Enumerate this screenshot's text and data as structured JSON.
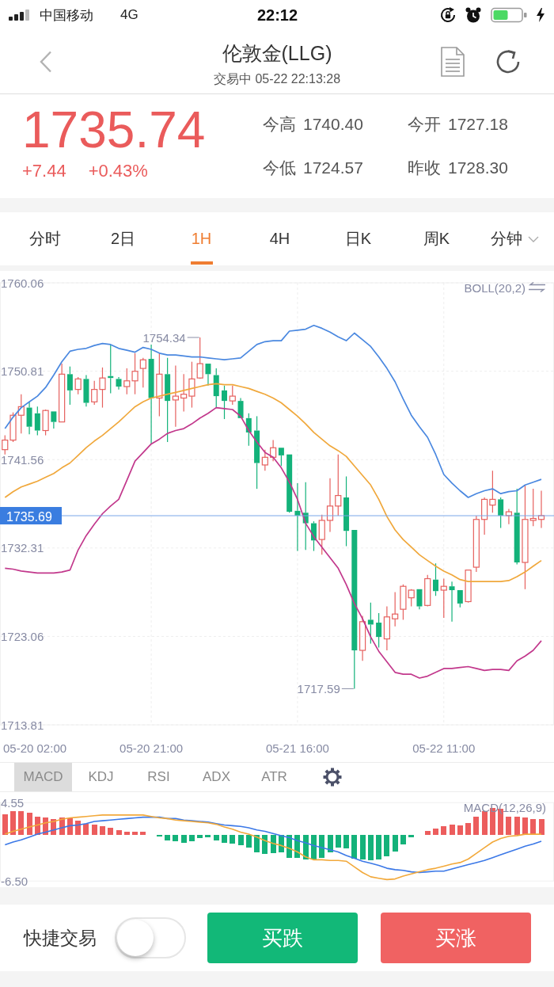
{
  "status_bar": {
    "carrier": "中国移动",
    "network": "4G",
    "time": "22:12"
  },
  "nav": {
    "title": "伦敦金(LLG)",
    "subtitle": "交易中 05-22 22:13:28"
  },
  "quote": {
    "price": "1735.74",
    "change": "+7.44",
    "change_percent": "+0.43%",
    "stats": [
      {
        "label": "今高",
        "value": "1740.40"
      },
      {
        "label": "今开",
        "value": "1727.18"
      },
      {
        "label": "今低",
        "value": "1724.57"
      },
      {
        "label": "昨收",
        "value": "1728.30"
      }
    ]
  },
  "period_tabs": [
    {
      "label": "分时",
      "selected": false,
      "dropdown": false
    },
    {
      "label": "2日",
      "selected": false,
      "dropdown": false
    },
    {
      "label": "1H",
      "selected": true,
      "dropdown": false
    },
    {
      "label": "4H",
      "selected": false,
      "dropdown": false
    },
    {
      "label": "日K",
      "selected": false,
      "dropdown": false
    },
    {
      "label": "周K",
      "selected": false,
      "dropdown": false
    },
    {
      "label": "分钟",
      "selected": false,
      "dropdown": true
    }
  ],
  "main_chart": {
    "chart_data": {
      "type": "candlestick",
      "title": "BOLL(20,2)",
      "grid": true,
      "categories": [
        null,
        null,
        null,
        null,
        null,
        null,
        null,
        null,
        null,
        null,
        null,
        null,
        null,
        null,
        null,
        null,
        null,
        null,
        "05-20 21:00",
        null,
        null,
        null,
        null,
        null,
        null,
        null,
        null,
        null,
        null,
        null,
        null,
        null,
        null,
        null,
        null,
        null,
        "05-21 16:00",
        null,
        null,
        null,
        null,
        null,
        null,
        null,
        null,
        null,
        null,
        null,
        null,
        null,
        null,
        null,
        null,
        null,
        "05-22 11:00",
        null,
        null,
        null,
        null,
        null,
        null,
        null,
        null,
        null,
        null,
        null,
        null
      ],
      "ylim": [
        1713.81,
        1760.06
      ],
      "yticks": [
        1760.06,
        1750.81,
        1741.56,
        1732.31,
        1723.06,
        1713.81
      ],
      "ohlc": [
        [
          1742.6,
          1744.1,
          1742.1,
          1743.6
        ],
        [
          1743.6,
          1746.5,
          1743.4,
          1746.2
        ],
        [
          1746.2,
          1748.4,
          1744.3,
          1747.1
        ],
        [
          1747.0,
          1747.6,
          1744.2,
          1745.0
        ],
        [
          1746.4,
          1747.1,
          1744.1,
          1744.6
        ],
        [
          1744.6,
          1746.8,
          1744.1,
          1746.7
        ],
        [
          1746.6,
          1746.6,
          1744.8,
          1745.5
        ],
        [
          1745.5,
          1751.6,
          1745.5,
          1750.5
        ],
        [
          1750.5,
          1751.3,
          1747.3,
          1748.8
        ],
        [
          1748.9,
          1750.2,
          1748.4,
          1750.0
        ],
        [
          1750.0,
          1750.4,
          1747.1,
          1747.5
        ],
        [
          1747.6,
          1749.8,
          1747.3,
          1748.9
        ],
        [
          1748.9,
          1751.2,
          1747.0,
          1750.1
        ],
        [
          1750.3,
          1753.6,
          1748.5,
          1750.1
        ],
        [
          1750.0,
          1750.2,
          1748.9,
          1749.2
        ],
        [
          1749.2,
          1751.1,
          1748.4,
          1749.8
        ],
        [
          1749.8,
          1752.7,
          1748.4,
          1750.8
        ],
        [
          1751.1,
          1752.2,
          1749.1,
          1752.0
        ],
        [
          1752.1,
          1753.6,
          1743.2,
          1748.0
        ],
        [
          1748.0,
          1752.7,
          1746.1,
          1750.5
        ],
        [
          1750.5,
          1752.2,
          1743.4,
          1747.7
        ],
        [
          1747.8,
          1751.4,
          1745.0,
          1748.2
        ],
        [
          1748.0,
          1750.5,
          1746.6,
          1748.4
        ],
        [
          1748.2,
          1751.8,
          1747.0,
          1750.0
        ],
        [
          1750.1,
          1754.34,
          1750.0,
          1751.6
        ],
        [
          1751.6,
          1751.6,
          1749.3,
          1750.5
        ],
        [
          1750.4,
          1751.1,
          1747.0,
          1748.2
        ],
        [
          1748.8,
          1749.3,
          1745.8,
          1747.7
        ],
        [
          1747.7,
          1749.3,
          1747.3,
          1748.2
        ],
        [
          1747.7,
          1748.0,
          1745.9,
          1745.9
        ],
        [
          1745.9,
          1746.4,
          1743.0,
          1744.4
        ],
        [
          1744.6,
          1746.1,
          1738.5,
          1741.2
        ],
        [
          1741.0,
          1742.6,
          1740.4,
          1741.8
        ],
        [
          1741.8,
          1743.6,
          1741.4,
          1742.8
        ],
        [
          1742.8,
          1742.8,
          1740.9,
          1742.0
        ],
        [
          1742.1,
          1742.1,
          1736.0,
          1736.1
        ],
        [
          1736.2,
          1739.1,
          1732.0,
          1735.7
        ],
        [
          1736.0,
          1739.2,
          1732.1,
          1734.9
        ],
        [
          1734.9,
          1735.1,
          1732.0,
          1733.1
        ],
        [
          1733.2,
          1735.8,
          1731.6,
          1735.2
        ],
        [
          1735.2,
          1739.6,
          1734.0,
          1736.7
        ],
        [
          1736.7,
          1742.1,
          1735.7,
          1737.8
        ],
        [
          1737.6,
          1739.8,
          1732.5,
          1734.1
        ],
        [
          1734.2,
          1734.2,
          1717.59,
          1721.6
        ],
        [
          1721.6,
          1725.2,
          1720.5,
          1724.6
        ],
        [
          1724.8,
          1726.6,
          1722.3,
          1724.3
        ],
        [
          1724.5,
          1725.5,
          1721.9,
          1723.0
        ],
        [
          1722.8,
          1726.2,
          1721.6,
          1725.1
        ],
        [
          1724.9,
          1727.7,
          1724.1,
          1725.4
        ],
        [
          1725.9,
          1728.5,
          1724.8,
          1728.3
        ],
        [
          1727.1,
          1728.0,
          1726.2,
          1727.9
        ],
        [
          1728.0,
          1728.0,
          1725.9,
          1726.2
        ],
        [
          1726.3,
          1729.5,
          1726.2,
          1729.1
        ],
        [
          1729.0,
          1730.7,
          1727.3,
          1727.8
        ],
        [
          1727.9,
          1729.1,
          1725.0,
          1728.3
        ],
        [
          1728.3,
          1728.8,
          1724.6,
          1727.9
        ],
        [
          1727.9,
          1727.9,
          1726.1,
          1726.5
        ],
        [
          1726.7,
          1730.0,
          1726.6,
          1730.0
        ],
        [
          1730.3,
          1735.7,
          1729.8,
          1735.3
        ],
        [
          1735.3,
          1737.6,
          1733.7,
          1737.4
        ],
        [
          1736.8,
          1740.4,
          1736.0,
          1737.4
        ],
        [
          1737.4,
          1737.6,
          1734.4,
          1735.7
        ],
        [
          1735.7,
          1736.4,
          1734.8,
          1736.1
        ],
        [
          1736.0,
          1738.5,
          1730.6,
          1730.8
        ],
        [
          1730.8,
          1738.9,
          1728.0,
          1735.3
        ],
        [
          1735.2,
          1738.5,
          1734.6,
          1735.4
        ],
        [
          1735.3,
          1738.3,
          1734.4,
          1735.7
        ]
      ],
      "series": [
        {
          "type": "line",
          "color": "#4a88e0",
          "values": [
            1744.8,
            1746.0,
            1747.0,
            1747.6,
            1748.2,
            1749.1,
            1750.4,
            1751.8,
            1752.9,
            1753.1,
            1753.2,
            1753.5,
            1753.7,
            1753.6,
            1753.2,
            1753.0,
            1752.8,
            1753.3,
            1753.1,
            1752.7,
            1752.5,
            1752.5,
            1752.4,
            1752.3,
            1752.3,
            1752.2,
            1752.1,
            1752.0,
            1752.1,
            1752.2,
            1752.9,
            1753.6,
            1753.9,
            1754.0,
            1754.0,
            1755.0,
            1755.1,
            1755.2,
            1755.6,
            1755.3,
            1754.9,
            1754.4,
            1754.0,
            1754.8,
            1754.1,
            1753.4,
            1752.3,
            1751.1,
            1749.7,
            1747.9,
            1746.2,
            1745.0,
            1743.9,
            1742.1,
            1740.0,
            1739.1,
            1738.3,
            1737.6,
            1738.0,
            1738.3,
            1738.5,
            1738.0,
            1738.2,
            1738.3,
            1738.9,
            1739.2,
            1739.5
          ]
        },
        {
          "type": "line",
          "color": "#f0a83c",
          "values": [
            1737.6,
            1738.2,
            1738.7,
            1739.0,
            1739.3,
            1739.7,
            1740.1,
            1740.7,
            1741.2,
            1742.0,
            1742.8,
            1743.5,
            1744.1,
            1744.8,
            1745.5,
            1746.3,
            1747.1,
            1747.6,
            1748.0,
            1748.2,
            1748.4,
            1748.6,
            1748.8,
            1749.0,
            1749.2,
            1749.4,
            1749.5,
            1749.4,
            1749.4,
            1749.2,
            1749.0,
            1748.7,
            1748.4,
            1748.0,
            1747.5,
            1746.8,
            1746.1,
            1745.3,
            1744.4,
            1743.7,
            1743.0,
            1742.5,
            1741.9,
            1740.9,
            1739.9,
            1738.9,
            1737.4,
            1735.6,
            1734.2,
            1733.2,
            1732.4,
            1731.6,
            1731.0,
            1730.4,
            1729.9,
            1729.5,
            1729.0,
            1728.8,
            1728.8,
            1728.8,
            1728.8,
            1728.8,
            1728.9,
            1729.3,
            1729.8,
            1730.4,
            1731.0
          ]
        },
        {
          "type": "line",
          "color": "#c2388c",
          "values": [
            1730.2,
            1730.1,
            1729.9,
            1729.8,
            1729.7,
            1729.7,
            1729.7,
            1729.8,
            1730.0,
            1732.1,
            1733.6,
            1734.8,
            1735.9,
            1736.7,
            1737.4,
            1739.4,
            1741.4,
            1742.3,
            1743.2,
            1743.7,
            1744.3,
            1744.6,
            1744.8,
            1745.3,
            1745.9,
            1746.4,
            1747.0,
            1746.9,
            1746.8,
            1746.1,
            1744.6,
            1743.4,
            1742.3,
            1741.8,
            1740.7,
            1739.2,
            1737.4,
            1734.9,
            1733.5,
            1732.4,
            1731.3,
            1730.2,
            1728.5,
            1726.5,
            1724.9,
            1723.0,
            1721.5,
            1720.4,
            1719.3,
            1719.1,
            1719.1,
            1718.7,
            1718.9,
            1719.3,
            1719.7,
            1719.7,
            1719.8,
            1719.9,
            1719.7,
            1719.5,
            1719.6,
            1719.6,
            1719.5,
            1720.5,
            1721.0,
            1721.6,
            1722.6
          ]
        }
      ],
      "ref_lines": [
        {
          "axis": "y",
          "value": 1735.69,
          "label": "1735.69",
          "color": "#7aa6e8"
        }
      ],
      "annotations": [
        "1754.34",
        "1717.59",
        "05-20 02:00"
      ]
    }
  },
  "indicator_tabs": [
    {
      "label": "MACD",
      "selected": true
    },
    {
      "label": "KDJ",
      "selected": false
    },
    {
      "label": "RSI",
      "selected": false
    },
    {
      "label": "ADX",
      "selected": false
    },
    {
      "label": "ATR",
      "selected": false
    }
  ],
  "macd_chart": {
    "chart_data": {
      "type": "bar",
      "title": "MACD(12,26,9)",
      "ylim": [
        -6.5,
        4.55
      ],
      "yticks": [
        4.55,
        {
          "value": -6.5,
          "label": "-6.50"
        }
      ],
      "series": [
        {
          "values": [
            2.9,
            3.3,
            3.4,
            3.1,
            2.6,
            2.5,
            2.2,
            2.5,
            2.3,
            2.0,
            1.6,
            1.4,
            1.2,
            1.0,
            0.7,
            0.5,
            0.5,
            0.5,
            null,
            -0.2,
            -0.8,
            -0.9,
            -1.1,
            -0.9,
            -0.4,
            -0.3,
            -0.8,
            -1.1,
            -1.2,
            -1.4,
            -1.8,
            -2.5,
            -2.7,
            -2.6,
            -2.5,
            -3.2,
            -3.2,
            -3.5,
            -3.5,
            -3.2,
            -2.5,
            -1.8,
            -1.9,
            -3.3,
            -3.5,
            -3.6,
            -3.5,
            -3.0,
            -2.3,
            -1.3,
            -0.3,
            null,
            0.6,
            0.9,
            1.2,
            1.4,
            1.3,
            1.7,
            2.6,
            3.3,
            3.8,
            3.7,
            2.6,
            2.6,
            2.4,
            2.2,
            2.2
          ],
          "colors": [
            "#ec5d5d",
            "#ec5d5d",
            "#ec5d5d",
            "#ec5d5d",
            "#ec5d5d",
            "#ec5d5d",
            "#ec5d5d",
            "#ec5d5d",
            "#ec5d5d",
            "#ec5d5d",
            "#ec5d5d",
            "#ec5d5d",
            "#ec5d5d",
            "#ec5d5d",
            "#ec5d5d",
            "#ec5d5d",
            "#ec5d5d",
            "#ec5d5d",
            null,
            "#14b27a",
            "#14b27a",
            "#14b27a",
            "#14b27a",
            "#14b27a",
            "#14b27a",
            "#14b27a",
            "#14b27a",
            "#14b27a",
            "#14b27a",
            "#14b27a",
            "#14b27a",
            "#14b27a",
            "#14b27a",
            "#14b27a",
            "#14b27a",
            "#14b27a",
            "#14b27a",
            "#14b27a",
            "#14b27a",
            "#14b27a",
            "#14b27a",
            "#14b27a",
            "#14b27a",
            "#14b27a",
            "#14b27a",
            "#14b27a",
            "#14b27a",
            "#14b27a",
            "#14b27a",
            "#14b27a",
            "#14b27a",
            null,
            "#ec5d5d",
            "#ec5d5d",
            "#ec5d5d",
            "#ec5d5d",
            "#ec5d5d",
            "#ec5d5d",
            "#ec5d5d",
            "#ec5d5d",
            "#ec5d5d",
            "#ec5d5d",
            "#ec5d5d",
            "#ec5d5d",
            "#ec5d5d",
            "#ec5d5d",
            "#ec5d5d"
          ]
        },
        {
          "type": "line",
          "color": "#3b78e7",
          "values": [
            -1.4,
            -1.0,
            -0.7,
            -0.3,
            0.1,
            0.4,
            0.7,
            1.0,
            1.3,
            1.4,
            1.6,
            1.9,
            2.0,
            2.1,
            2.2,
            2.3,
            2.4,
            2.5,
            2.5,
            2.5,
            2.3,
            2.3,
            2.1,
            2.0,
            1.9,
            1.8,
            1.6,
            1.4,
            1.3,
            1.2,
            1.0,
            0.7,
            0.5,
            0.2,
            -0.1,
            -0.4,
            -0.8,
            -1.1,
            -1.5,
            -1.8,
            -2.1,
            -2.4,
            -2.9,
            -3.3,
            -3.7,
            -4.0,
            -4.3,
            -4.7,
            -4.9,
            -5.0,
            -5.2,
            -5.3,
            -5.2,
            -5.1,
            -5.1,
            -4.8,
            -4.5,
            -4.2,
            -3.9,
            -3.6,
            -3.2,
            -2.8,
            -2.4,
            -2.0,
            -1.6,
            -1.3,
            -0.9
          ]
        },
        {
          "type": "line",
          "color": "#f2a93b",
          "values": [
            0.1,
            0.5,
            0.8,
            1.1,
            1.4,
            1.7,
            1.9,
            2.2,
            2.4,
            2.5,
            2.6,
            2.7,
            2.8,
            2.8,
            2.8,
            2.8,
            2.8,
            2.8,
            2.6,
            2.4,
            2.3,
            2.1,
            2.0,
            1.9,
            1.8,
            1.7,
            1.5,
            1.1,
            0.8,
            0.4,
            0.1,
            -0.3,
            -0.8,
            -1.2,
            -1.5,
            -1.9,
            -2.4,
            -3.1,
            -3.5,
            -3.5,
            -3.6,
            -3.6,
            -3.7,
            -4.5,
            -5.3,
            -5.9,
            -6.1,
            -6.3,
            -6.2,
            -5.8,
            -5.5,
            -5.2,
            -4.9,
            -4.7,
            -4.4,
            -4.1,
            -3.9,
            -3.4,
            -2.6,
            -1.8,
            -1.0,
            -0.5,
            -0.2,
            -0.1,
            0.1,
            0.1,
            0.1
          ]
        }
      ]
    }
  },
  "bottom_bar": {
    "quick_trade": {
      "label": "快捷交易",
      "on": false
    },
    "buttons": [
      {
        "label": "买跌",
        "kind": "down"
      },
      {
        "label": "买涨",
        "kind": "up"
      }
    ]
  }
}
